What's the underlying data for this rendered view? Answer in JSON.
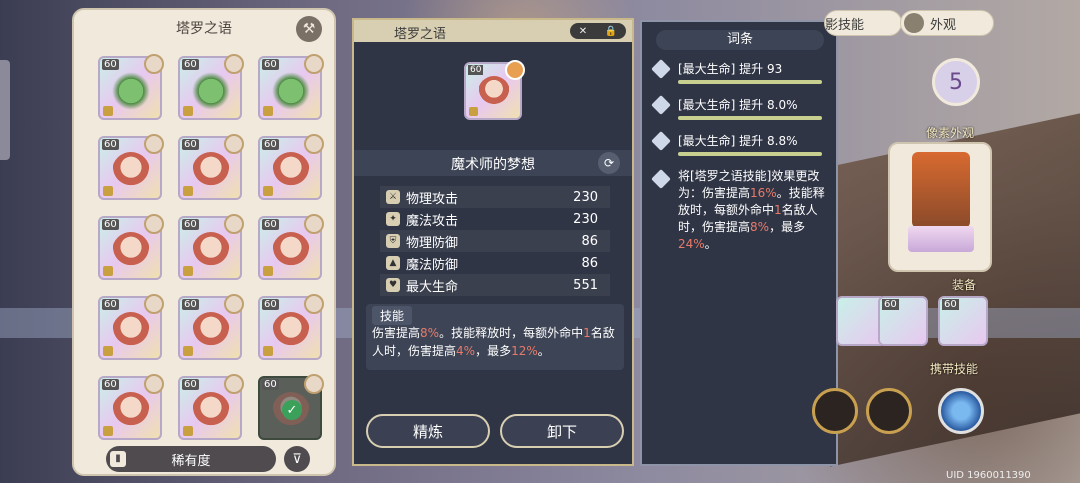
{
  "left_panel": {
    "title": "塔罗之语",
    "card_level": "60",
    "rarity_label": "稀有度",
    "hammer_icon": "hammer-icon",
    "filter_icon": "filter-icon"
  },
  "detail": {
    "header_title": "塔罗之语",
    "card_level": "60",
    "name": "魔术师的梦想",
    "stats": [
      {
        "icon": "sword-icon",
        "label": "物理攻击",
        "value": "230"
      },
      {
        "icon": "wand-icon",
        "label": "魔法攻击",
        "value": "230"
      },
      {
        "icon": "shield-icon",
        "label": "物理防御",
        "value": "86"
      },
      {
        "icon": "magic-hat-icon",
        "label": "魔法防御",
        "value": "86"
      },
      {
        "icon": "heart-icon",
        "label": "最大生命",
        "value": "551"
      }
    ],
    "skill_label": "技能",
    "skill_text": {
      "p1": "伤害提高",
      "v1": "8%",
      "p2": "。技能释放时，每额外命中",
      "v2": "1",
      "p3": "名敌人时，伤害提高",
      "v3": "4%",
      "p4": "，最多",
      "v4": "12%",
      "p5": "。"
    },
    "refine_button": "精炼",
    "unequip_button": "卸下"
  },
  "affixes": {
    "header": "词条",
    "items": [
      {
        "text": "[最大生命] 提升 93",
        "fill": 0.9
      },
      {
        "text": "[最大生命] 提升 8.0%",
        "fill": 0.9
      },
      {
        "text": "[最大生命] 提升 8.8%",
        "fill": 0.9
      }
    ],
    "special": {
      "p1": "将[塔罗之语技能]效果更改为：伤害提高",
      "v1": "16%",
      "p2": "。技能释放时，每额外命中",
      "v2": "1",
      "p3": "名敌人时，伤害提高",
      "v3": "8%",
      "p4": "，最多",
      "v4": "24%",
      "p5": "。"
    }
  },
  "right": {
    "tab_skills": "影技能",
    "tab_appearance": "外观",
    "badge_value": "5",
    "appearance_label": "像素外观",
    "equip_label": "装备",
    "equip_level": "60",
    "carry_skill_label": "携带技能",
    "uid": "UID 1960011390"
  }
}
